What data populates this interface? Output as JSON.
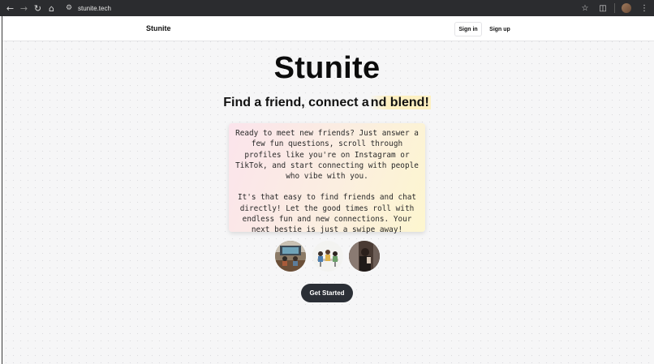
{
  "browser": {
    "url": "stunite.tech"
  },
  "header": {
    "brand": "Stunite",
    "sign_in": "Sign in",
    "sign_up": "Sign up"
  },
  "hero": {
    "title": "Stunite",
    "tagline_start": "Find a friend, connect a",
    "tagline_highlight": "nd blend!",
    "paragraph_1": "Ready to meet new friends? Just answer a few fun questions, scroll through profiles like you're on Instagram or TikTok, and start connecting with people who vibe with you.",
    "paragraph_2": "It's that easy to find friends and chat directly! Let the good times roll with endless fun and new connections. Your next bestie is just a swipe away!",
    "cta": "Get Started"
  },
  "photos": [
    {
      "name": "friends-photo-1"
    },
    {
      "name": "friends-photo-2"
    },
    {
      "name": "friends-photo-3"
    }
  ],
  "colors": {
    "chrome_bg": "#2b2c2f",
    "cta_bg": "#2b2f36",
    "highlight": "#fdf0c2"
  }
}
